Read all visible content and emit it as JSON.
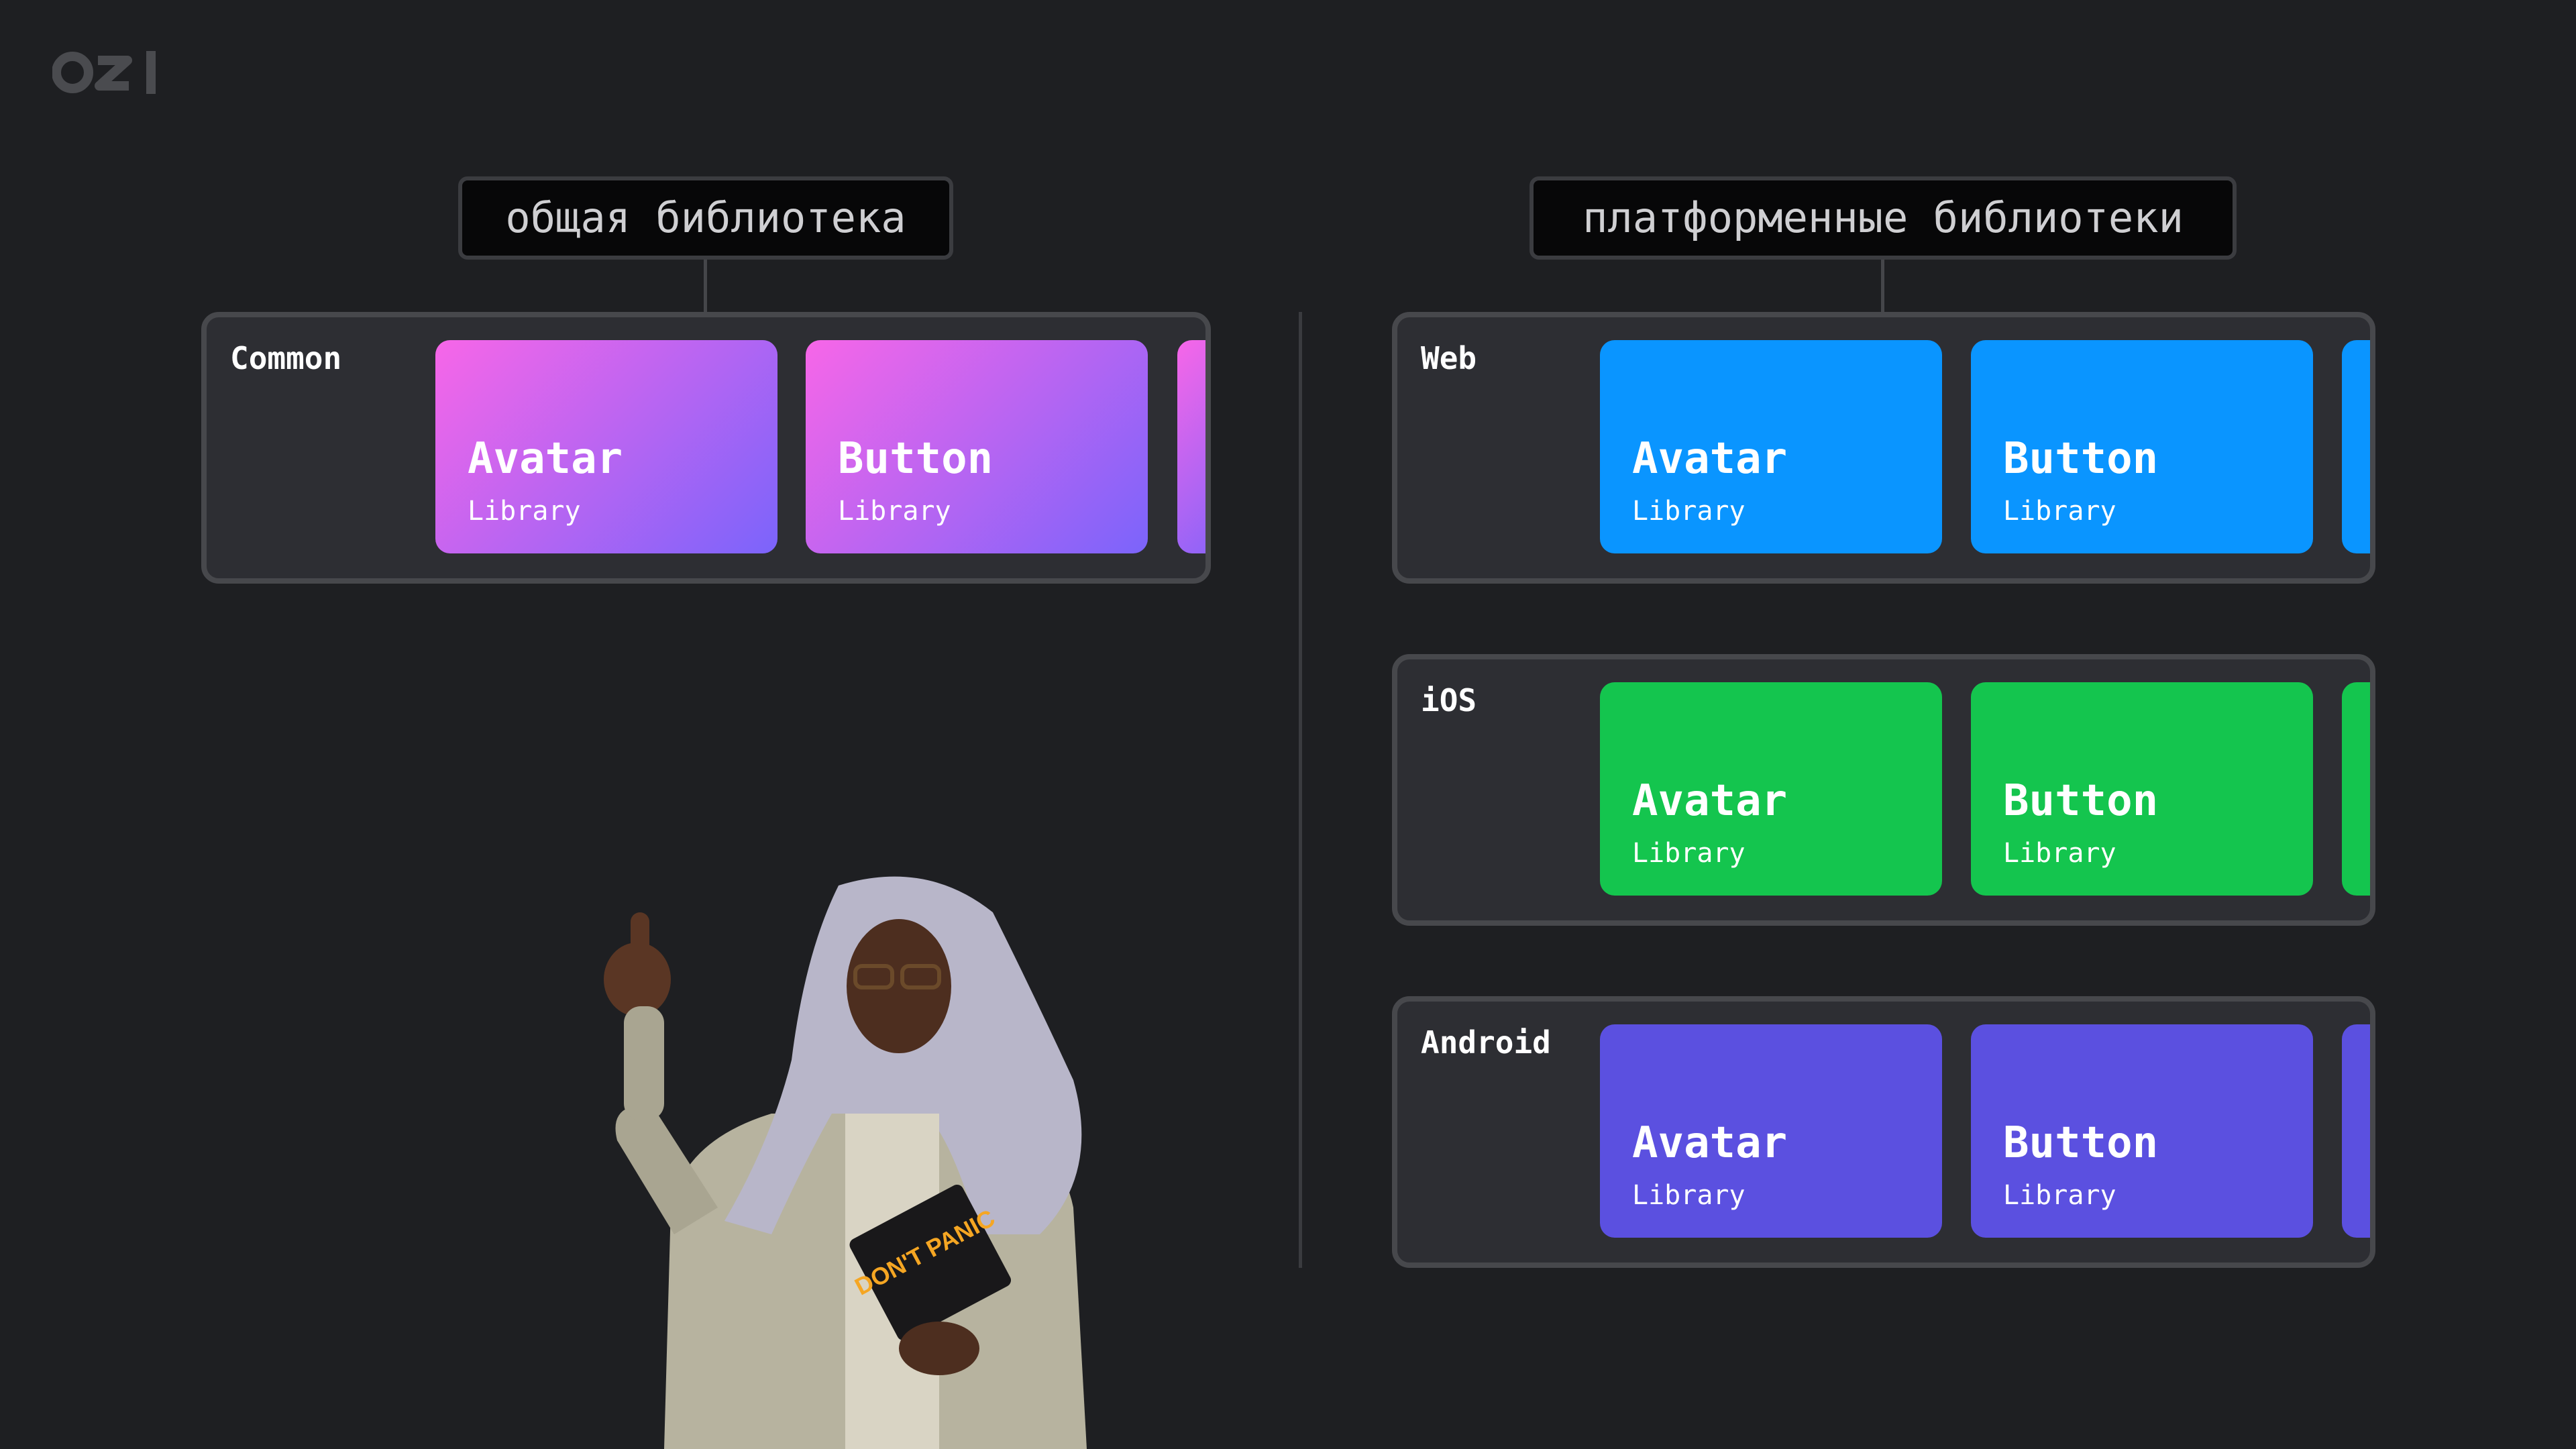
{
  "logo": {
    "text": "ozi"
  },
  "labels": {
    "common": "общая библиотека",
    "platform": "платформенные библиотеки"
  },
  "panels": [
    {
      "name": "Common",
      "cards": [
        {
          "title": "Avatar",
          "subtitle": "Library"
        },
        {
          "title": "Button",
          "subtitle": "Library"
        }
      ],
      "color": "gradient #f766e8 → #7b64fb"
    },
    {
      "name": "Web",
      "cards": [
        {
          "title": "Avatar",
          "subtitle": "Library"
        },
        {
          "title": "Button",
          "subtitle": "Library"
        }
      ],
      "color": "#0a95ff"
    },
    {
      "name": "iOS",
      "cards": [
        {
          "title": "Avatar",
          "subtitle": "Library"
        },
        {
          "title": "Button",
          "subtitle": "Library"
        }
      ],
      "color": "#14c54e"
    },
    {
      "name": "Android",
      "cards": [
        {
          "title": "Avatar",
          "subtitle": "Library"
        },
        {
          "title": "Button",
          "subtitle": "Library"
        }
      ],
      "color": "#5b50e0"
    }
  ],
  "figure": {
    "badge_text": "DON'T PANIC"
  }
}
